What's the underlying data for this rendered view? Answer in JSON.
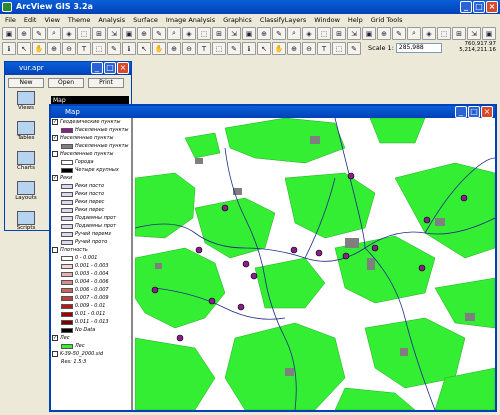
{
  "app": {
    "title": "ArcView GIS 3.2a"
  },
  "menu": [
    "File",
    "Edit",
    "View",
    "Theme",
    "Analysis",
    "Surface",
    "Image Analysis",
    "Graphics",
    "ClassifyLayers",
    "Window",
    "Help",
    "Grid Tools"
  ],
  "scale": {
    "label": "Scale 1:",
    "value": "285,988"
  },
  "coords": {
    "x": "760,917.97",
    "y": "5,214,211.16"
  },
  "project": {
    "title": "vur.apr",
    "buttons": [
      "New",
      "Open",
      "Print"
    ],
    "items": [
      "Views",
      "Tables",
      "Charts",
      "Layouts",
      "Scripts"
    ],
    "selected_view": "Map"
  },
  "map": {
    "title": "Map",
    "legend": {
      "gauss": "Геодезические пункты",
      "settle_pts": "Населенные пункты",
      "settle_poly": "Населенные пункты",
      "towns": "Города",
      "settle_other": "Четыре крупных",
      "rivers": "Реки",
      "river_items": [
        "Реки посто",
        "Реки посто",
        "Реки перес",
        "Реки перес",
        "Подземны прот",
        "Подземны прот",
        "Ручей перемз",
        "Ручей прото"
      ],
      "density": "Плотность",
      "density_items": [
        "0 - 0.001",
        "0.001 - 0.003",
        "0.003 - 0.004",
        "0.004 - 0.006",
        "0.006 - 0.007",
        "0.007 - 0.009",
        "0.009 - 0.01",
        "0.01 - 0.011",
        "0.011 - 0.013",
        "No Data"
      ],
      "forest": "Лес",
      "raster": "K-39-50_2000.sid",
      "res": "Res: 1.5:3"
    }
  },
  "colors": {
    "forest": "#33ee33",
    "settle": "#7f7f7f",
    "river": "#1f2a8a",
    "point": "#8a1f8a"
  }
}
